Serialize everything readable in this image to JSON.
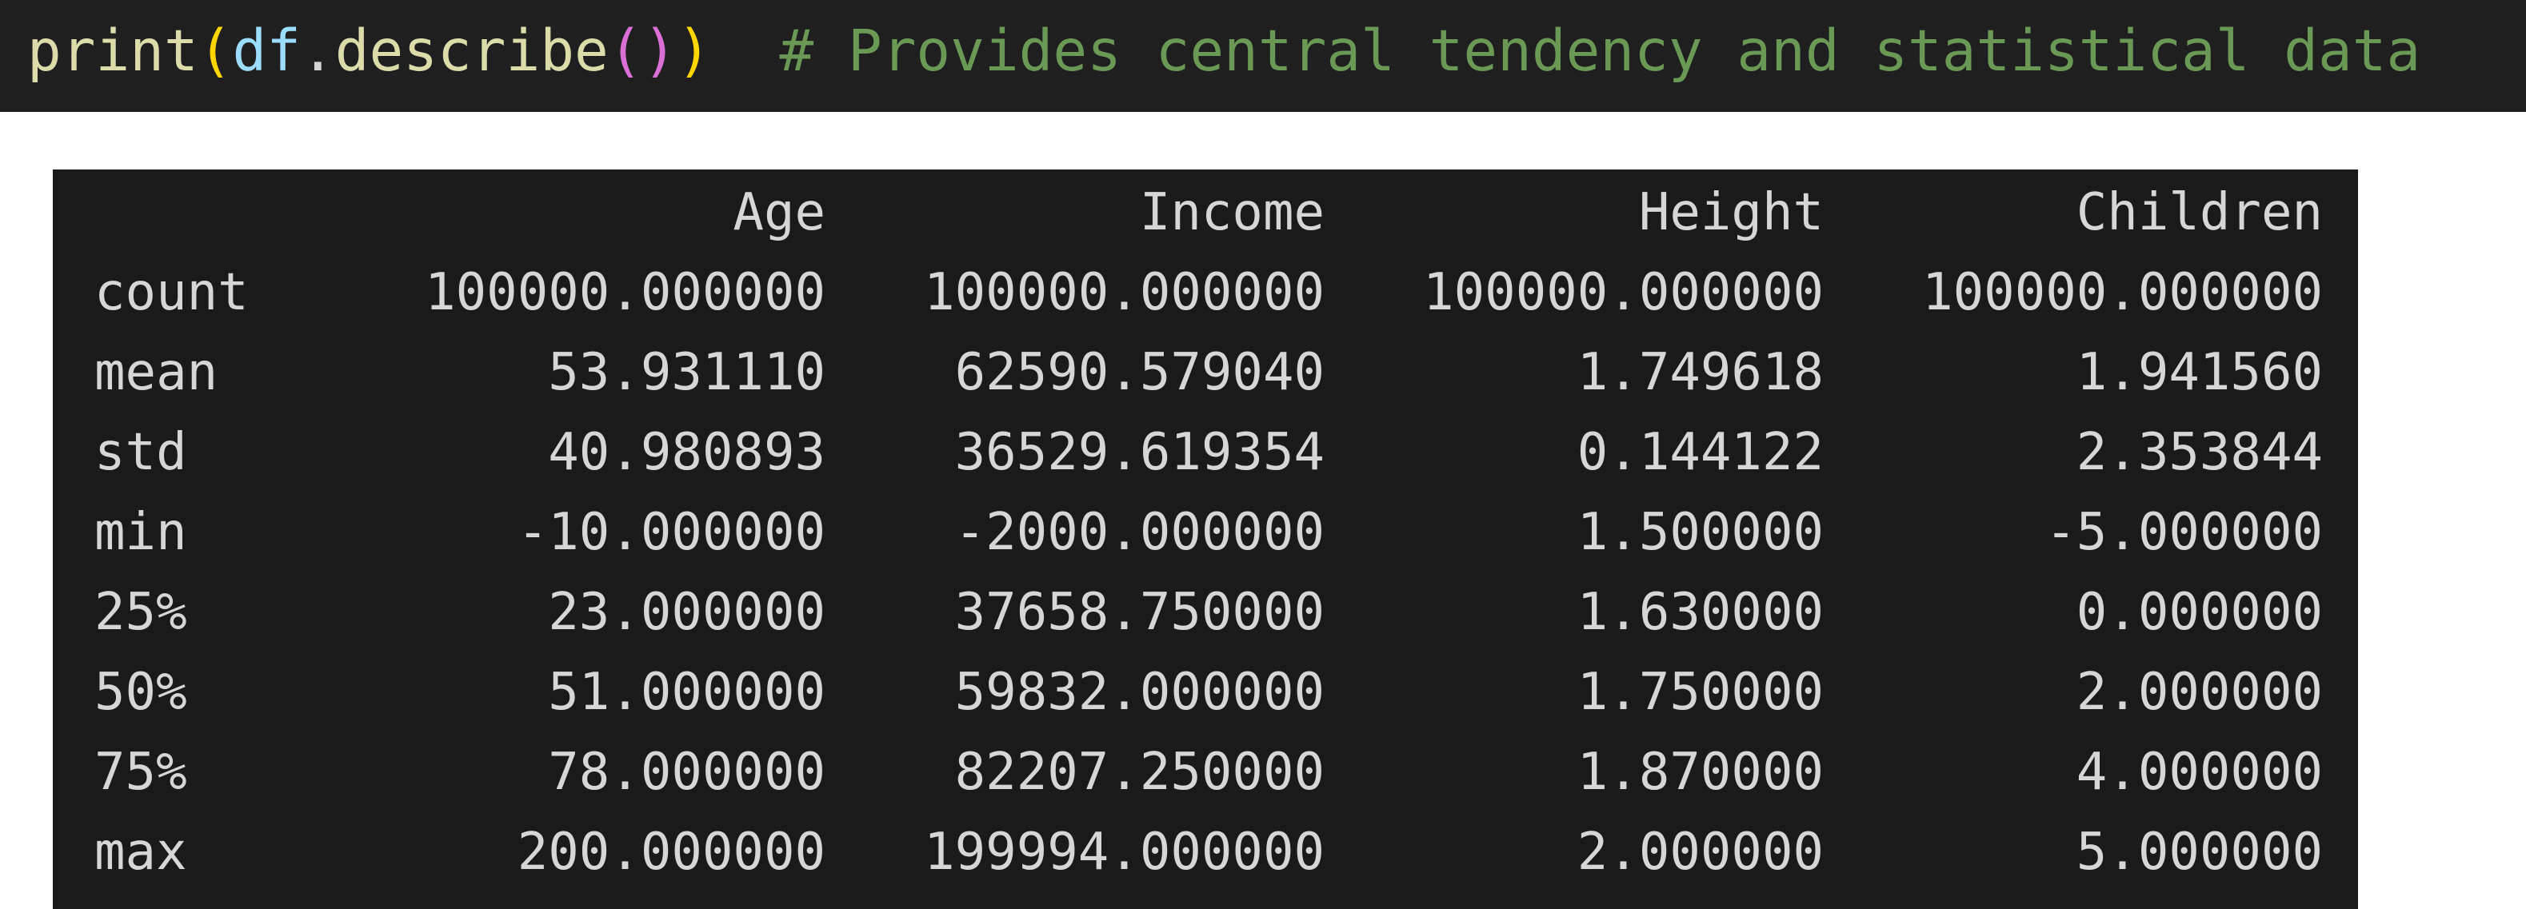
{
  "code": {
    "function_name": "print",
    "open_paren_outer": "(",
    "variable": "df",
    "dot": ".",
    "method": "describe",
    "inner_parens": "()",
    "close_paren_outer": ")",
    "comment": "# Provides central tendency and statistical data"
  },
  "colors": {
    "editor_background": "#1f1f1f",
    "output_background": "#1a1a1a",
    "function": "#dcdcaa",
    "variable": "#9cdcfe",
    "bracket_outer": "#ffd700",
    "bracket_inner": "#da70d6",
    "comment": "#6a9955",
    "output_text": "#d6d6d6"
  },
  "table": {
    "columns": [
      "Age",
      "Income",
      "Height",
      "Children"
    ],
    "rows": [
      {
        "stat": "count",
        "values": [
          "100000.000000",
          "100000.000000",
          "100000.000000",
          "100000.000000"
        ]
      },
      {
        "stat": "mean",
        "values": [
          "53.931110",
          "62590.579040",
          "1.749618",
          "1.941560"
        ]
      },
      {
        "stat": "std",
        "values": [
          "40.980893",
          "36529.619354",
          "0.144122",
          "2.353844"
        ]
      },
      {
        "stat": "min",
        "values": [
          "-10.000000",
          "-2000.000000",
          "1.500000",
          "-5.000000"
        ]
      },
      {
        "stat": "25%",
        "values": [
          "23.000000",
          "37658.750000",
          "1.630000",
          "0.000000"
        ]
      },
      {
        "stat": "50%",
        "values": [
          "51.000000",
          "59832.000000",
          "1.750000",
          "2.000000"
        ]
      },
      {
        "stat": "75%",
        "values": [
          "78.000000",
          "82207.250000",
          "1.870000",
          "4.000000"
        ]
      },
      {
        "stat": "max",
        "values": [
          "200.000000",
          "199994.000000",
          "2.000000",
          "5.000000"
        ]
      }
    ]
  }
}
